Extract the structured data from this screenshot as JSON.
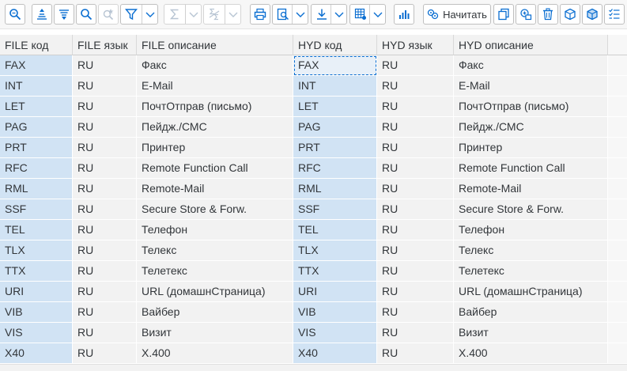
{
  "toolbar": {
    "items": [
      {
        "icon": "zoom-details-icon",
        "enabled": true
      },
      {
        "icon": "sort-ascending-icon",
        "enabled": true
      },
      {
        "icon": "sort-descending-icon",
        "enabled": true
      },
      {
        "icon": "find-icon",
        "enabled": true
      },
      {
        "icon": "find-next-icon",
        "enabled": false
      },
      {
        "icon": "filter-icon",
        "enabled": true
      },
      {
        "icon": "sum-icon",
        "enabled": false
      },
      {
        "icon": "subtotal-icon",
        "enabled": false
      },
      {
        "icon": "print-icon",
        "enabled": true
      },
      {
        "icon": "print-preview-icon",
        "enabled": true
      },
      {
        "icon": "export-icon",
        "enabled": true
      },
      {
        "icon": "layout-icon",
        "enabled": true
      },
      {
        "icon": "chart-icon",
        "enabled": true
      },
      {
        "icon": "start-icon",
        "enabled": true
      },
      {
        "icon": "copy-icon",
        "enabled": true
      },
      {
        "icon": "copy-entry-icon",
        "enabled": true
      },
      {
        "icon": "delete-icon",
        "enabled": true
      },
      {
        "icon": "transport-icon",
        "enabled": true
      },
      {
        "icon": "transport-all-icon",
        "enabled": true
      },
      {
        "icon": "select-list-icon",
        "enabled": true
      }
    ],
    "start_label": "Начитать"
  },
  "table": {
    "columns": [
      "FILE код",
      "FILE язык",
      "FILE описание",
      "HYD код",
      "HYD язык",
      "HYD описание"
    ],
    "rows": [
      [
        "FAX",
        "RU",
        "Факс",
        "FAX",
        "RU",
        "Факс"
      ],
      [
        "INT",
        "RU",
        "E-Mail",
        "INT",
        "RU",
        "E-Mail"
      ],
      [
        "LET",
        "RU",
        "ПочтОтправ (письмо)",
        "LET",
        "RU",
        "ПочтОтправ (письмо)"
      ],
      [
        "PAG",
        "RU",
        "Пейдж./СМС",
        "PAG",
        "RU",
        "Пейдж./СМС"
      ],
      [
        "PRT",
        "RU",
        "Принтер",
        "PRT",
        "RU",
        "Принтер"
      ],
      [
        "RFC",
        "RU",
        "Remote Function Call",
        "RFC",
        "RU",
        "Remote Function Call"
      ],
      [
        "RML",
        "RU",
        "Remote-Mail",
        "RML",
        "RU",
        "Remote-Mail"
      ],
      [
        "SSF",
        "RU",
        "Secure Store & Forw.",
        "SSF",
        "RU",
        "Secure Store & Forw."
      ],
      [
        "TEL",
        "RU",
        "Телефон",
        "TEL",
        "RU",
        "Телефон"
      ],
      [
        "TLX",
        "RU",
        "Телекс",
        "TLX",
        "RU",
        "Телекс"
      ],
      [
        "TTX",
        "RU",
        "Телетекс",
        "TTX",
        "RU",
        "Телетекс"
      ],
      [
        "URI",
        "RU",
        "URL (домашнСтраница)",
        "URI",
        "RU",
        "URL (домашнСтраница)"
      ],
      [
        "VIB",
        "RU",
        "Вайбер",
        "VIB",
        "RU",
        "Вайбер"
      ],
      [
        "VIS",
        "RU",
        "Визит",
        "VIS",
        "RU",
        "Визит"
      ],
      [
        "X40",
        "RU",
        "X.400",
        "X40",
        "RU",
        "X.400"
      ]
    ]
  },
  "colors": {
    "accent": "#0a6ed1",
    "key_cell_bg": "#d1e3f4",
    "cell_bg": "#f2f2f2"
  }
}
